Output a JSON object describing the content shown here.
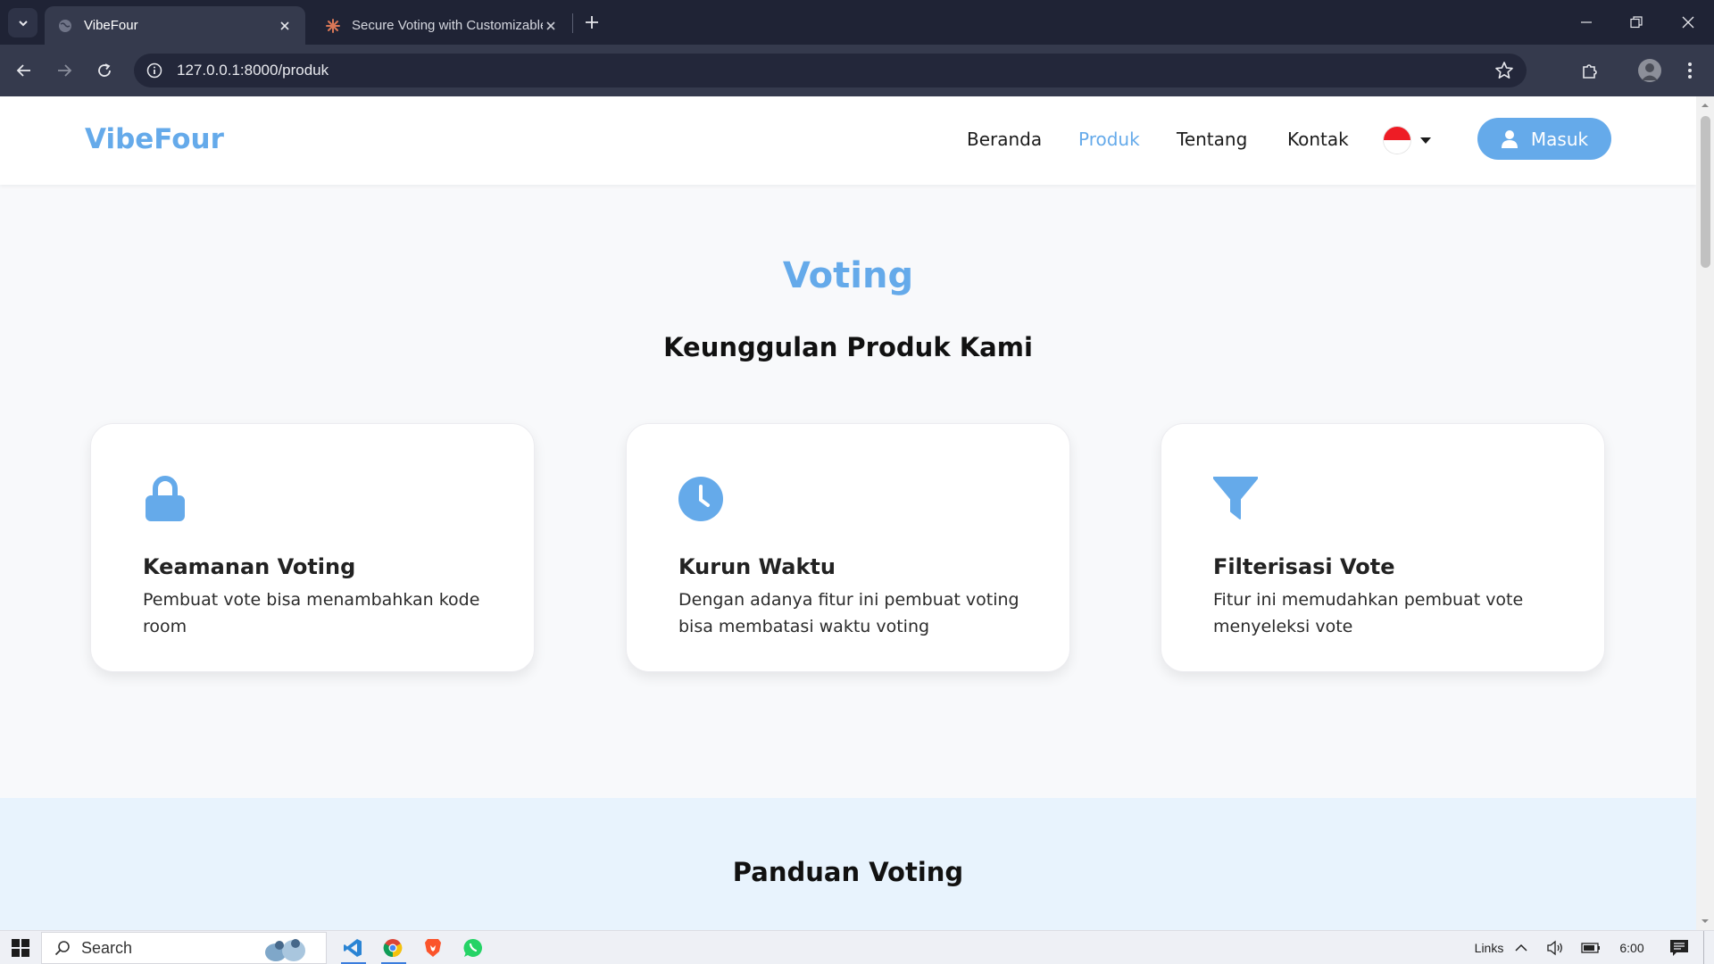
{
  "browser": {
    "tabs": [
      {
        "title": "VibeFour",
        "active": true
      },
      {
        "title": "Secure Voting with Customizable",
        "active": false
      }
    ],
    "url": "127.0.0.1:8000/produk"
  },
  "header": {
    "brand": "VibeFour",
    "nav": [
      "Beranda",
      "Produk",
      "Tentang",
      "Kontak"
    ],
    "active_nav": "Produk",
    "login_label": "Masuk"
  },
  "hero": {
    "title": "Voting",
    "subtitle": "Keunggulan Produk Kami"
  },
  "features": [
    {
      "icon": "lock-icon",
      "title": "Keamanan Voting",
      "description": "Pembuat vote bisa menambahkan kode room"
    },
    {
      "icon": "clock-icon",
      "title": "Kurun Waktu",
      "description": "Dengan adanya fitur ini pembuat voting bisa membatasi waktu voting"
    },
    {
      "icon": "filter-icon",
      "title": "Filterisasi Vote",
      "description": "Fitur ini memudahkan pembuat vote menyeleksi vote"
    }
  ],
  "guide": {
    "title": "Panduan Voting"
  },
  "taskbar": {
    "search_label": "Search",
    "tray_links": "Links",
    "clock": "6:00"
  },
  "colors": {
    "accent": "#65aaea",
    "chrome_dark": "#1f2335",
    "chrome_toolbar": "#353a4d",
    "guide_bg": "#e8f3fd"
  }
}
